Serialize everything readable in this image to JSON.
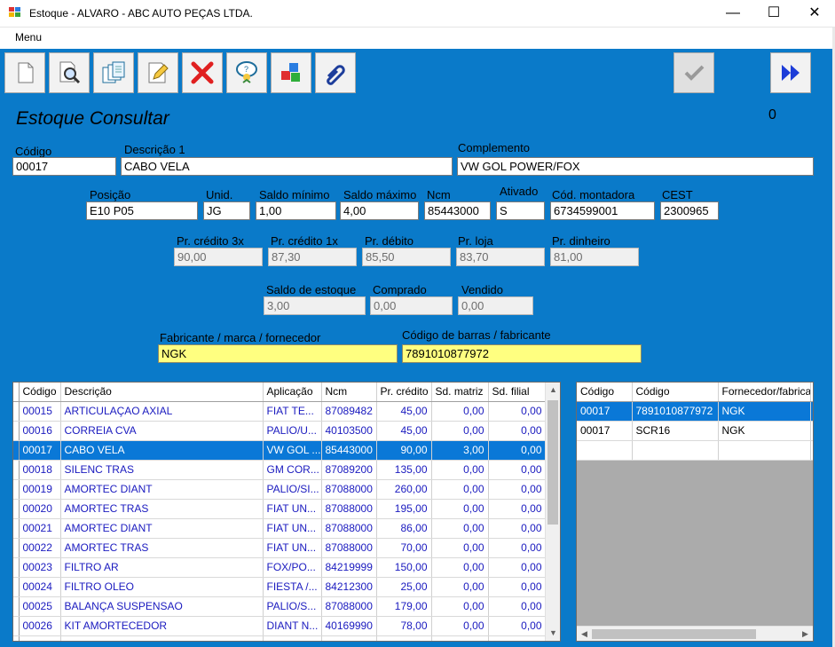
{
  "window": {
    "title": "Estoque - ALVARO - ABC AUTO PEÇAS LTDA.",
    "minimize": "—",
    "maximize": "☐",
    "close": "✕"
  },
  "menu": {
    "label": "Menu"
  },
  "page": {
    "title": "Estoque  Consultar",
    "counter": "0"
  },
  "form": {
    "codigo": {
      "label": "Código",
      "value": "00017"
    },
    "descricao1": {
      "label": "Descrição 1",
      "value": "CABO VELA"
    },
    "complemento": {
      "label": "Complemento",
      "value": "VW GOL POWER/FOX"
    },
    "posicao": {
      "label": "Posição",
      "value": "E10 P05"
    },
    "unid": {
      "label": "Unid.",
      "value": "JG"
    },
    "saldo_minimo": {
      "label": "Saldo mínimo",
      "value": "1,00"
    },
    "saldo_maximo": {
      "label": "Saldo máximo",
      "value": "4,00"
    },
    "ncm": {
      "label": "Ncm",
      "value": "85443000"
    },
    "ativado": {
      "label": "Ativado",
      "value": "S"
    },
    "cod_montadora": {
      "label": "Cód. montadora",
      "value": "6734599001"
    },
    "cest": {
      "label": "CEST",
      "value": "2300965"
    },
    "pr_credito_3x": {
      "label": "Pr. crédito 3x",
      "value": "90,00"
    },
    "pr_credito_1x": {
      "label": "Pr. crédito 1x",
      "value": "87,30"
    },
    "pr_debito": {
      "label": "Pr. débito",
      "value": "85,50"
    },
    "pr_loja": {
      "label": "Pr. loja",
      "value": "83,70"
    },
    "pr_dinheiro": {
      "label": "Pr. dinheiro",
      "value": "81,00"
    },
    "saldo_estoque": {
      "label": "Saldo de estoque",
      "value": "3,00"
    },
    "comprado": {
      "label": "Comprado",
      "value": "0,00"
    },
    "vendido": {
      "label": "Vendido",
      "value": "0,00"
    },
    "fabricante": {
      "label": "Fabricante / marca / fornecedor",
      "value": "NGK"
    },
    "codigo_barras": {
      "label": "Código de barras / fabricante",
      "value": "7891010877972"
    }
  },
  "toolbar": {
    "buttons": [
      "new-icon",
      "search-icon",
      "list-icon",
      "edit-icon",
      "delete-icon",
      "help-icon",
      "cubes-icon",
      "attach-icon"
    ],
    "confirm": "check-icon",
    "next": "fast-forward-icon"
  },
  "stock_grid": {
    "columns": [
      "Código",
      "Descrição",
      "Aplicação",
      "Ncm",
      "Pr. crédito",
      "Sd. matriz",
      "Sd. filial"
    ],
    "rows": [
      [
        "00015",
        "ARTICULAÇAO AXIAL",
        "FIAT TE...",
        "87089482",
        "45,00",
        "0,00",
        "0,00"
      ],
      [
        "00016",
        "CORREIA CVA",
        "PALIO/U...",
        "40103500",
        "45,00",
        "0,00",
        "0,00"
      ],
      [
        "00017",
        "CABO VELA",
        "VW GOL ...",
        "85443000",
        "90,00",
        "3,00",
        "0,00"
      ],
      [
        "00018",
        "SILENC TRAS",
        "GM COR...",
        "87089200",
        "135,00",
        "0,00",
        "0,00"
      ],
      [
        "00019",
        "AMORTEC DIANT",
        "PALIO/SI...",
        "87088000",
        "260,00",
        "0,00",
        "0,00"
      ],
      [
        "00020",
        "AMORTEC TRAS",
        "FIAT UN...",
        "87088000",
        "195,00",
        "0,00",
        "0,00"
      ],
      [
        "00021",
        "AMORTEC DIANT",
        "FIAT UN...",
        "87088000",
        "86,00",
        "0,00",
        "0,00"
      ],
      [
        "00022",
        "AMORTEC TRAS",
        "FIAT UN...",
        "87088000",
        "70,00",
        "0,00",
        "0,00"
      ],
      [
        "00023",
        "FILTRO AR",
        "FOX/PO...",
        "84219999",
        "150,00",
        "0,00",
        "0,00"
      ],
      [
        "00024",
        "FILTRO OLEO",
        "FIESTA /...",
        "84212300",
        "25,00",
        "0,00",
        "0,00"
      ],
      [
        "00025",
        "BALANÇA SUSPENSAO",
        "PALIO/S...",
        "87088000",
        "179,00",
        "0,00",
        "0,00"
      ],
      [
        "00026",
        "KIT AMORTECEDOR",
        "DIANT N...",
        "40169990",
        "78,00",
        "0,00",
        "0,00"
      ]
    ],
    "selected_index": 2
  },
  "barcode_grid": {
    "columns": [
      "Código",
      "Código",
      "Fornecedor/fabrica"
    ],
    "rows": [
      [
        "00017",
        "7891010877972",
        "NGK"
      ],
      [
        "00017",
        "SCR16",
        "NGK"
      ]
    ],
    "selected_index": 0
  }
}
